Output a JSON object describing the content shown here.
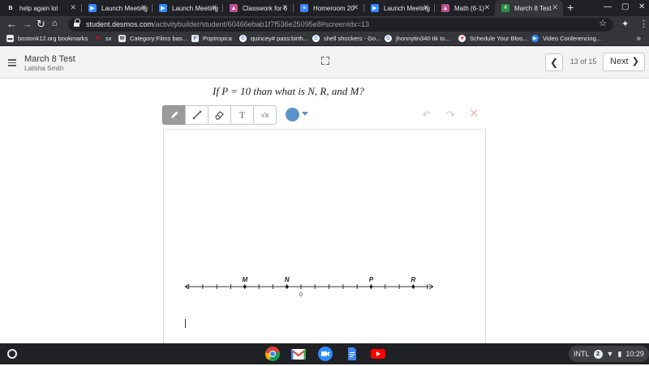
{
  "browser": {
    "tabs": [
      {
        "title": "help again lol",
        "favicon": "brainly-icon",
        "color": "#202124",
        "active": false
      },
      {
        "title": "Launch Meeting",
        "favicon": "zoom-icon",
        "color": "#2d8cff",
        "active": false
      },
      {
        "title": "Launch Meeting",
        "favicon": "zoom-icon",
        "color": "#2d8cff",
        "active": false
      },
      {
        "title": "Classwork for 6",
        "favicon": "classroom-icon",
        "color": "#c04f8f",
        "active": false
      },
      {
        "title": "Homeroom 20",
        "favicon": "docs-icon",
        "color": "#4285f4",
        "active": false
      },
      {
        "title": "Launch Meeting",
        "favicon": "zoom-icon",
        "color": "#2d8cff",
        "active": false
      },
      {
        "title": "Math (6-1)",
        "favicon": "classroom-icon",
        "color": "#c04f8f",
        "active": false
      },
      {
        "title": "March 8 Test",
        "favicon": "desmos-icon",
        "color": "#2f8f46",
        "active": true
      }
    ],
    "url_host": "student.desmos.com",
    "url_path": "/activitybuilder/student/60466ebab1f7f536e25095e8#screenIdx=13",
    "bookmarks": [
      {
        "label": "bostonk12.org bookmarks",
        "icon": "folder-icon"
      },
      {
        "label": "sx",
        "icon": "netflix-icon"
      },
      {
        "label": "Category:Films bas...",
        "icon": "wikipedia-icon"
      },
      {
        "label": "Poptropica",
        "icon": "poptropica-icon"
      },
      {
        "label": "quincey# pass:birth...",
        "icon": "google-icon"
      },
      {
        "label": "shell shockers - Go...",
        "icon": "google-icon"
      },
      {
        "label": "jhonnytin340 tik to...",
        "icon": "google-icon"
      },
      {
        "label": "Schedule Your Bloo...",
        "icon": "red-cross-icon"
      },
      {
        "label": "Video Conferencing...",
        "icon": "zoom-icon"
      }
    ]
  },
  "activity": {
    "title": "March 8 Test",
    "student": "Latisha Smith",
    "page_counter": "13 of 15",
    "next_label": "Next"
  },
  "question": {
    "text": "If P = 10 than what is N, R, and M?"
  },
  "sketch": {
    "tools": [
      "pencil-icon",
      "line-icon",
      "eraser-icon",
      "text-icon",
      "math-icon"
    ],
    "active_tool": "pencil-icon",
    "text_tool_label": "T",
    "math_tool_label": "√x",
    "pen_color": "#5b93c9"
  },
  "number_line": {
    "points": [
      {
        "label": "M",
        "tick": -4
      },
      {
        "label": "N",
        "tick": -1
      },
      {
        "label": "P",
        "tick": 5
      },
      {
        "label": "R",
        "tick": 8
      }
    ],
    "zero_label": "0",
    "zero_tick": 0,
    "min_tick": -8,
    "max_tick": 9
  },
  "shelf": {
    "apps": [
      "chrome-icon",
      "gmail-icon",
      "meet-icon",
      "docs-icon",
      "youtube-icon"
    ],
    "ime": "INTL",
    "notification_count": "2",
    "time": "10:29"
  }
}
